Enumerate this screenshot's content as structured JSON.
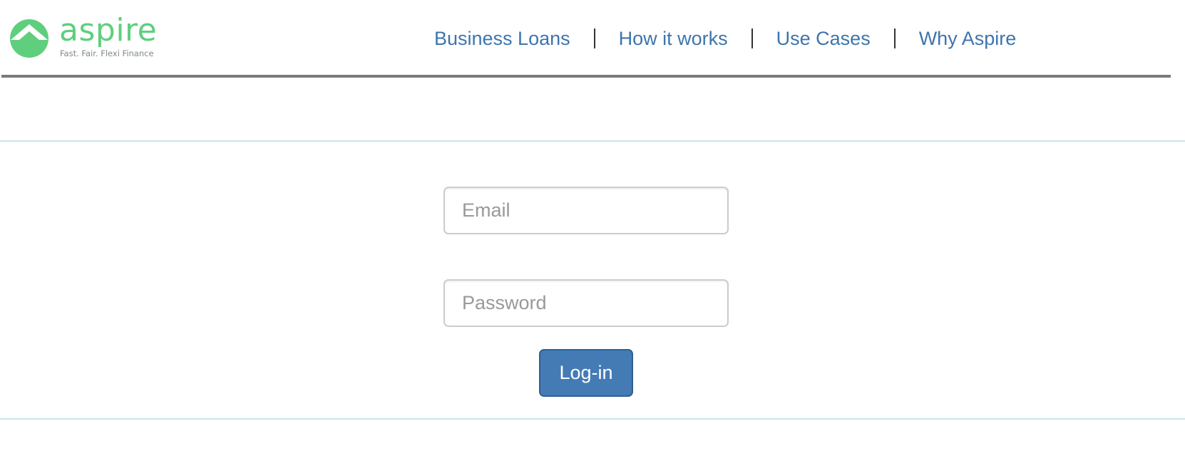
{
  "brand": {
    "name": "aspire",
    "tagline": "Fast. Fair. Flexi Finance",
    "color": "#5fcf7e"
  },
  "nav": {
    "items": [
      {
        "label": "Business Loans"
      },
      {
        "label": "How it works"
      },
      {
        "label": "Use Cases"
      },
      {
        "label": "Why Aspire"
      }
    ],
    "separator": "|",
    "link_color": "#3d75ad"
  },
  "login": {
    "email_placeholder": "Email",
    "email_value": "",
    "password_placeholder": "Password",
    "password_value": "",
    "button_label": "Log-in",
    "button_color": "#447bb5"
  },
  "icons": {
    "logo_mark": "chevron-up-in-circle-icon"
  }
}
